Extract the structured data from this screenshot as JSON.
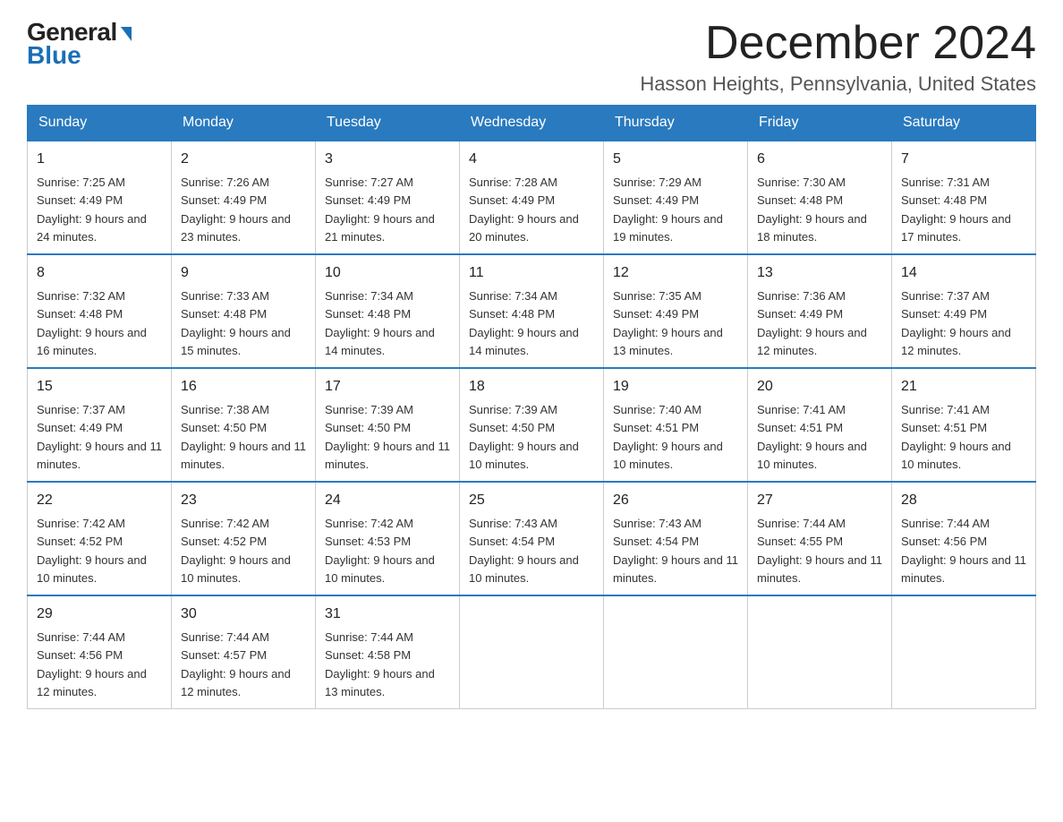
{
  "logo": {
    "general": "General",
    "blue": "Blue",
    "arrow": "▶"
  },
  "header": {
    "month": "December 2024",
    "location": "Hasson Heights, Pennsylvania, United States"
  },
  "days_of_week": [
    "Sunday",
    "Monday",
    "Tuesday",
    "Wednesday",
    "Thursday",
    "Friday",
    "Saturday"
  ],
  "weeks": [
    [
      {
        "day": "1",
        "sunrise": "7:25 AM",
        "sunset": "4:49 PM",
        "daylight": "9 hours and 24 minutes."
      },
      {
        "day": "2",
        "sunrise": "7:26 AM",
        "sunset": "4:49 PM",
        "daylight": "9 hours and 23 minutes."
      },
      {
        "day": "3",
        "sunrise": "7:27 AM",
        "sunset": "4:49 PM",
        "daylight": "9 hours and 21 minutes."
      },
      {
        "day": "4",
        "sunrise": "7:28 AM",
        "sunset": "4:49 PM",
        "daylight": "9 hours and 20 minutes."
      },
      {
        "day": "5",
        "sunrise": "7:29 AM",
        "sunset": "4:49 PM",
        "daylight": "9 hours and 19 minutes."
      },
      {
        "day": "6",
        "sunrise": "7:30 AM",
        "sunset": "4:48 PM",
        "daylight": "9 hours and 18 minutes."
      },
      {
        "day": "7",
        "sunrise": "7:31 AM",
        "sunset": "4:48 PM",
        "daylight": "9 hours and 17 minutes."
      }
    ],
    [
      {
        "day": "8",
        "sunrise": "7:32 AM",
        "sunset": "4:48 PM",
        "daylight": "9 hours and 16 minutes."
      },
      {
        "day": "9",
        "sunrise": "7:33 AM",
        "sunset": "4:48 PM",
        "daylight": "9 hours and 15 minutes."
      },
      {
        "day": "10",
        "sunrise": "7:34 AM",
        "sunset": "4:48 PM",
        "daylight": "9 hours and 14 minutes."
      },
      {
        "day": "11",
        "sunrise": "7:34 AM",
        "sunset": "4:48 PM",
        "daylight": "9 hours and 14 minutes."
      },
      {
        "day": "12",
        "sunrise": "7:35 AM",
        "sunset": "4:49 PM",
        "daylight": "9 hours and 13 minutes."
      },
      {
        "day": "13",
        "sunrise": "7:36 AM",
        "sunset": "4:49 PM",
        "daylight": "9 hours and 12 minutes."
      },
      {
        "day": "14",
        "sunrise": "7:37 AM",
        "sunset": "4:49 PM",
        "daylight": "9 hours and 12 minutes."
      }
    ],
    [
      {
        "day": "15",
        "sunrise": "7:37 AM",
        "sunset": "4:49 PM",
        "daylight": "9 hours and 11 minutes."
      },
      {
        "day": "16",
        "sunrise": "7:38 AM",
        "sunset": "4:50 PM",
        "daylight": "9 hours and 11 minutes."
      },
      {
        "day": "17",
        "sunrise": "7:39 AM",
        "sunset": "4:50 PM",
        "daylight": "9 hours and 11 minutes."
      },
      {
        "day": "18",
        "sunrise": "7:39 AM",
        "sunset": "4:50 PM",
        "daylight": "9 hours and 10 minutes."
      },
      {
        "day": "19",
        "sunrise": "7:40 AM",
        "sunset": "4:51 PM",
        "daylight": "9 hours and 10 minutes."
      },
      {
        "day": "20",
        "sunrise": "7:41 AM",
        "sunset": "4:51 PM",
        "daylight": "9 hours and 10 minutes."
      },
      {
        "day": "21",
        "sunrise": "7:41 AM",
        "sunset": "4:51 PM",
        "daylight": "9 hours and 10 minutes."
      }
    ],
    [
      {
        "day": "22",
        "sunrise": "7:42 AM",
        "sunset": "4:52 PM",
        "daylight": "9 hours and 10 minutes."
      },
      {
        "day": "23",
        "sunrise": "7:42 AM",
        "sunset": "4:52 PM",
        "daylight": "9 hours and 10 minutes."
      },
      {
        "day": "24",
        "sunrise": "7:42 AM",
        "sunset": "4:53 PM",
        "daylight": "9 hours and 10 minutes."
      },
      {
        "day": "25",
        "sunrise": "7:43 AM",
        "sunset": "4:54 PM",
        "daylight": "9 hours and 10 minutes."
      },
      {
        "day": "26",
        "sunrise": "7:43 AM",
        "sunset": "4:54 PM",
        "daylight": "9 hours and 11 minutes."
      },
      {
        "day": "27",
        "sunrise": "7:44 AM",
        "sunset": "4:55 PM",
        "daylight": "9 hours and 11 minutes."
      },
      {
        "day": "28",
        "sunrise": "7:44 AM",
        "sunset": "4:56 PM",
        "daylight": "9 hours and 11 minutes."
      }
    ],
    [
      {
        "day": "29",
        "sunrise": "7:44 AM",
        "sunset": "4:56 PM",
        "daylight": "9 hours and 12 minutes."
      },
      {
        "day": "30",
        "sunrise": "7:44 AM",
        "sunset": "4:57 PM",
        "daylight": "9 hours and 12 minutes."
      },
      {
        "day": "31",
        "sunrise": "7:44 AM",
        "sunset": "4:58 PM",
        "daylight": "9 hours and 13 minutes."
      },
      null,
      null,
      null,
      null
    ]
  ]
}
